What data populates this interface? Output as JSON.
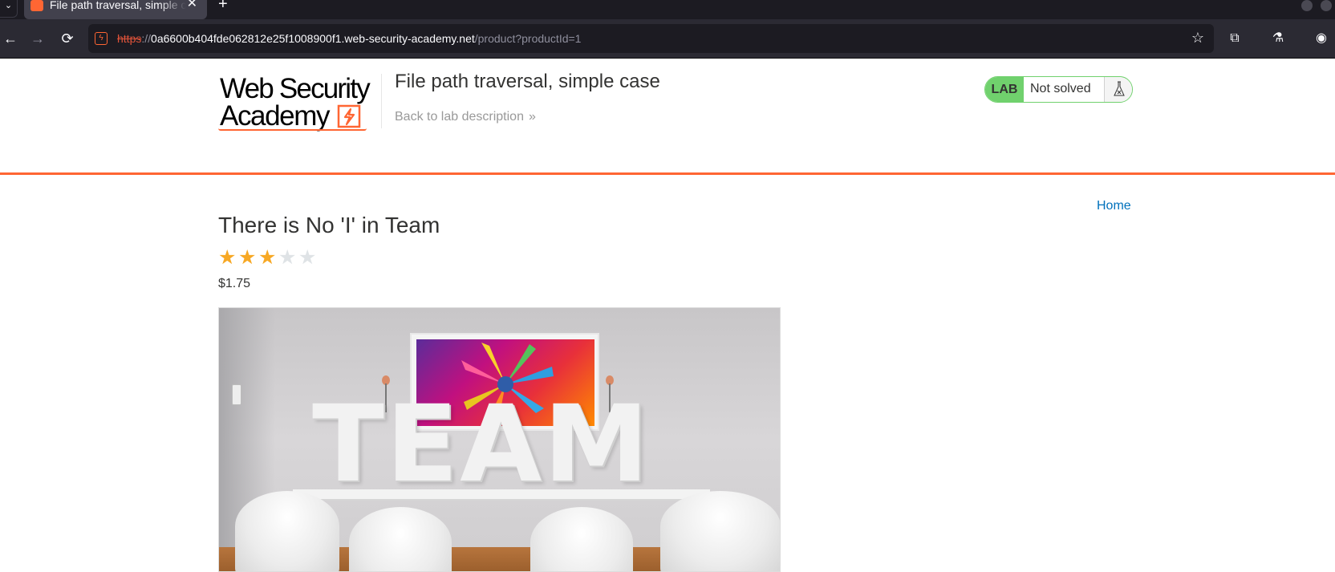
{
  "browser": {
    "tab": {
      "title": "File path traversal, simple case",
      "close_glyph": "✕"
    },
    "dropdown_glyph": "⌄",
    "new_tab_glyph": "+",
    "url": {
      "scheme": "https",
      "separator": "://",
      "host": "0a6600b404fde062812e25f1008900f1.web-security-academy.net",
      "path": "/product?productId=1"
    },
    "icons": {
      "back": "←",
      "forward": "→",
      "reload": "⟳",
      "bookmark": "☆",
      "extensions": "⧉",
      "labs": "⚗",
      "account": "◉"
    }
  },
  "header": {
    "logo": {
      "line1": "Web Security",
      "line2": "Academy"
    },
    "lab_title": "File path traversal, simple case",
    "back_link": "Back to lab description",
    "back_chevron": "»",
    "lab_badge": "LAB",
    "lab_state": "Not solved"
  },
  "nav": {
    "home": "Home"
  },
  "product": {
    "title": "There is No 'I' in Team",
    "rating": 3,
    "rating_max": 5,
    "price": "$1.75",
    "image_text": "TEAM"
  },
  "colors": {
    "accent": "#ff6633",
    "link": "#0071bc",
    "lab_green": "#70d16d",
    "star_on": "#f7a824",
    "star_off": "#dfe3e6"
  }
}
